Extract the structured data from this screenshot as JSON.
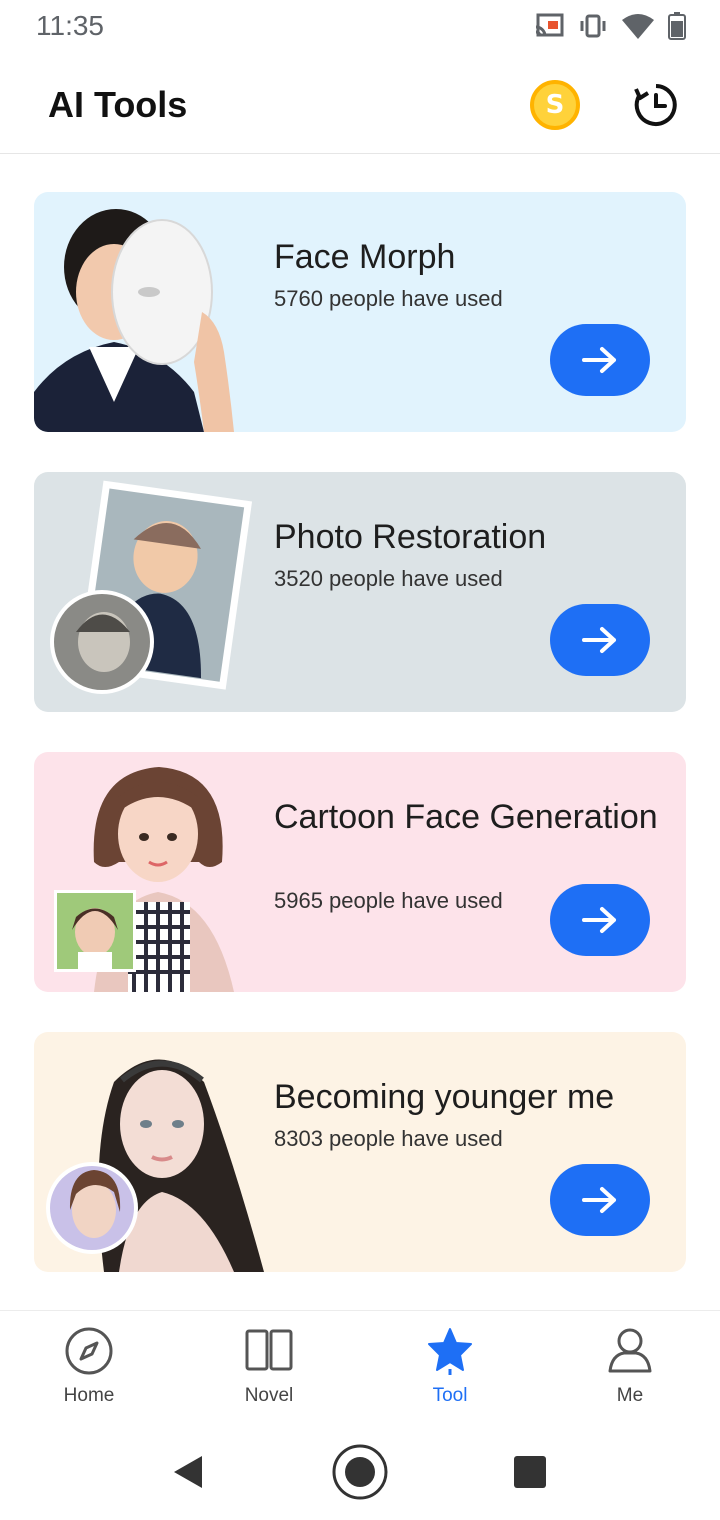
{
  "status": {
    "time": "11:35"
  },
  "header": {
    "title": "AI Tools",
    "coin_symbol": "S"
  },
  "cards": [
    {
      "title": "Face Morph",
      "subtitle": "5760 people have used",
      "bg": "#e1f3fd"
    },
    {
      "title": "Photo Restoration",
      "subtitle": "3520 people have used",
      "bg": "#dce3e6"
    },
    {
      "title": "Cartoon Face Generation",
      "subtitle": "5965 people have used",
      "bg": "#fde3ea"
    },
    {
      "title": "Becoming younger me",
      "subtitle": "8303 people have used",
      "bg": "#fdf3e5"
    }
  ],
  "nav": [
    {
      "label": "Home",
      "icon": "compass-icon",
      "active": false
    },
    {
      "label": "Novel",
      "icon": "book-icon",
      "active": false
    },
    {
      "label": "Tool",
      "icon": "star-icon",
      "active": true
    },
    {
      "label": "Me",
      "icon": "person-icon",
      "active": false
    }
  ],
  "colors": {
    "accent": "#1e6ff5",
    "coin": "#ffd23a"
  }
}
